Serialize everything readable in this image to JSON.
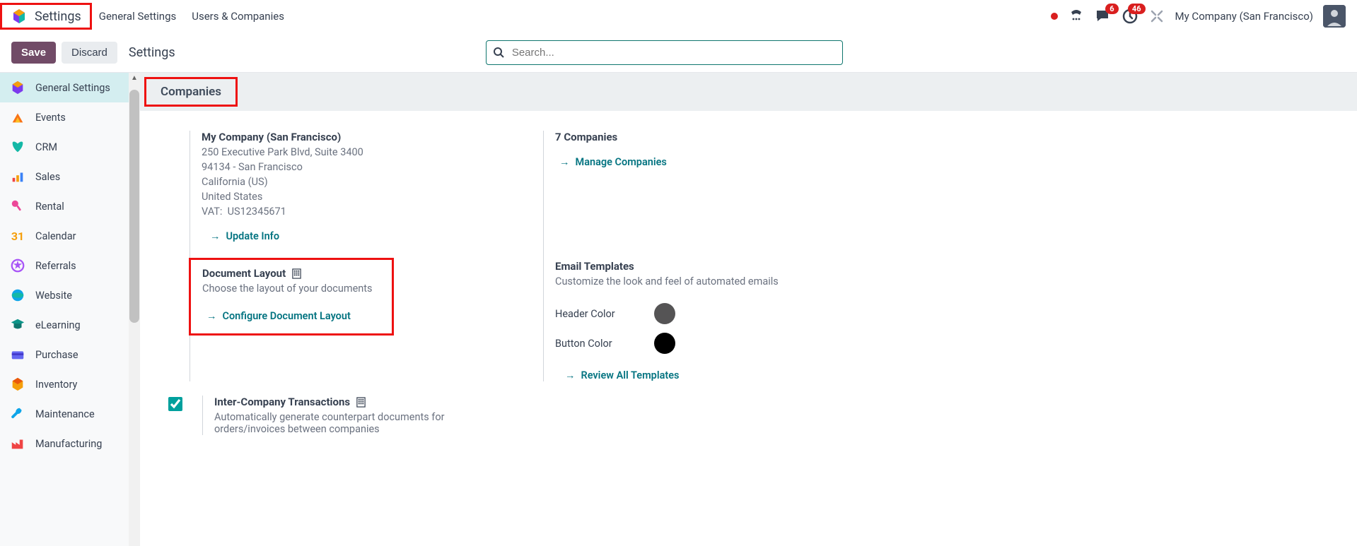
{
  "header": {
    "app_title": "Settings",
    "menu": [
      "General Settings",
      "Users & Companies"
    ],
    "badges": {
      "messages": "6",
      "activities": "46"
    },
    "company_name": "My Company (San Francisco)"
  },
  "controls": {
    "save": "Save",
    "discard": "Discard",
    "breadcrumb": "Settings",
    "search_placeholder": "Search..."
  },
  "sidebar": [
    {
      "label": "General Settings",
      "active": true
    },
    {
      "label": "Events"
    },
    {
      "label": "CRM"
    },
    {
      "label": "Sales"
    },
    {
      "label": "Rental"
    },
    {
      "label": "Calendar"
    },
    {
      "label": "Referrals"
    },
    {
      "label": "Website"
    },
    {
      "label": "eLearning"
    },
    {
      "label": "Purchase"
    },
    {
      "label": "Inventory"
    },
    {
      "label": "Maintenance"
    },
    {
      "label": "Manufacturing"
    }
  ],
  "section": {
    "title": "Companies"
  },
  "company": {
    "name": "My Company (San Francisco)",
    "addr1": "250 Executive Park Blvd, Suite 3400",
    "addr2": "94134 - San Francisco",
    "addr3": "California (US)",
    "addr4": "United States",
    "vat_label": "VAT:",
    "vat_value": "US12345671",
    "update_info": "Update Info"
  },
  "doc_layout": {
    "title": "Document Layout",
    "desc": "Choose the layout of your documents",
    "action": "Configure Document Layout"
  },
  "companies_panel": {
    "count_title": "7 Companies",
    "manage": "Manage Companies"
  },
  "email": {
    "title": "Email Templates",
    "desc": "Customize the look and feel of automated emails",
    "header_color_label": "Header Color",
    "button_color_label": "Button Color",
    "header_color": "#555455",
    "button_color": "#000000",
    "review": "Review All Templates"
  },
  "intercompany": {
    "title": "Inter-Company Transactions",
    "desc": "Automatically generate counterpart documents for orders/invoices between companies"
  }
}
